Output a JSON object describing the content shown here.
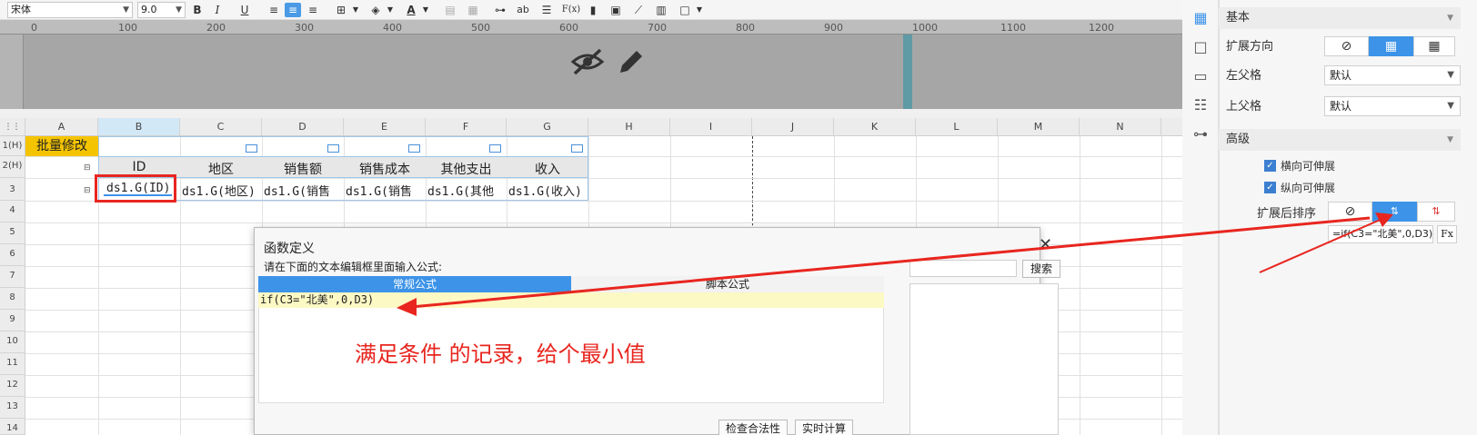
{
  "toolbar": {
    "font_name": "宋体",
    "font_size": "9.0",
    "bold": "B",
    "italic": "I",
    "underline": "U",
    "text_color_glyph": "A",
    "ab_label": "ab",
    "fx_label": "F(x)"
  },
  "ruler": {
    "marks": [
      "0",
      "100",
      "200",
      "300",
      "400",
      "500",
      "600",
      "700",
      "800",
      "900",
      "1000",
      "1100",
      "1200"
    ]
  },
  "columns": [
    "A",
    "B",
    "C",
    "D",
    "E",
    "F",
    "G",
    "H",
    "I",
    "J",
    "K",
    "L",
    "M",
    "N"
  ],
  "rows": [
    "1(H)",
    "2(H)",
    "3",
    "4",
    "5",
    "6",
    "7",
    "8",
    "9",
    "10",
    "11",
    "12",
    "13",
    "14"
  ],
  "sheet": {
    "title_cell": "批量修改",
    "headers": [
      "ID",
      "地区",
      "销售额",
      "销售成本",
      "其他支出",
      "收入"
    ],
    "data_cells": [
      "ds1.G(ID)",
      "ds1.G(地区)",
      "ds1.G(销售",
      "ds1.G(销售",
      "ds1.G(其他",
      "ds1.G(收入)"
    ]
  },
  "dialog": {
    "title": "函数定义",
    "instruction": "请在下面的文本编辑框里面输入公式:",
    "search_button": "搜索",
    "tab_normal": "常规公式",
    "tab_script": "脚本公式",
    "formula": "if(C3=\"北美\",0,D3)",
    "check_button": "检查合法性",
    "calc_button": "实时计算"
  },
  "annotation": {
    "text": "满足条件 的记录，给个最小值",
    "color": "#e8261f"
  },
  "right_panel": {
    "basic_section": "基本",
    "expand_direction_label": "扩展方向",
    "left_parent_label": "左父格",
    "left_parent_value": "默认",
    "top_parent_label": "上父格",
    "top_parent_value": "默认",
    "advanced_section": "高级",
    "horizontal_expand": "横向可伸展",
    "vertical_expand": "纵向可伸展",
    "sort_label": "扩展后排序",
    "sort_formula": "=if(C3=\"北美\",0,D3)",
    "fx_label": "Fx"
  },
  "colors": {
    "accent": "#3c93e8",
    "title_cell_bg": "#f5c400",
    "band": "#a6a6a6"
  }
}
